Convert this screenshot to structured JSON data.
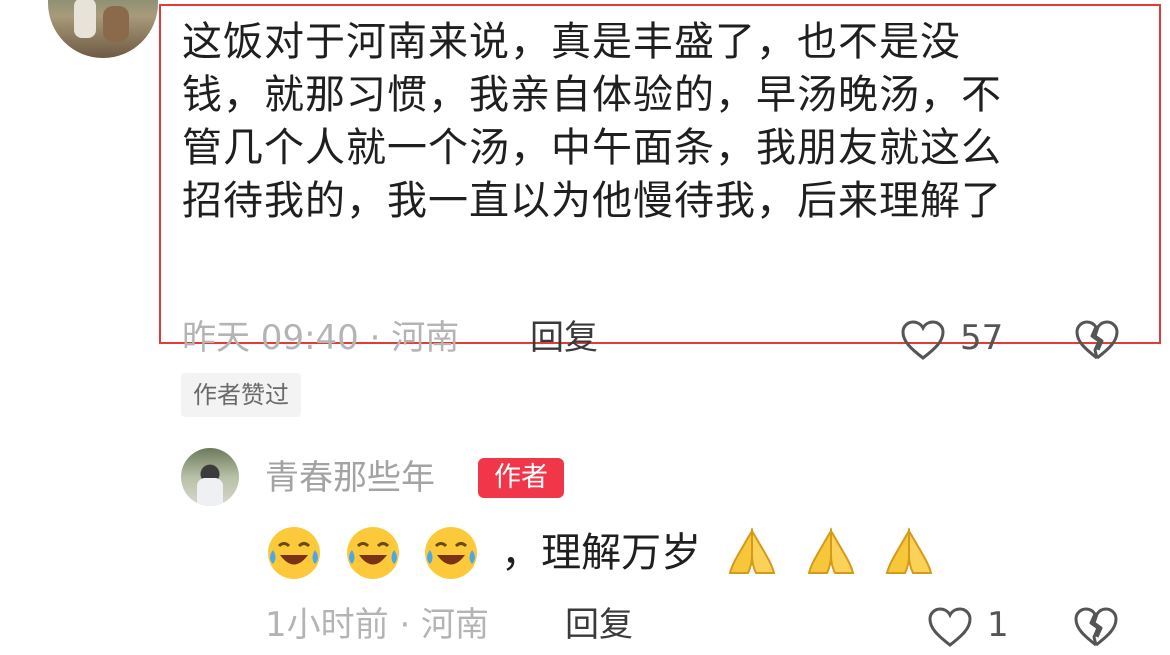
{
  "comment": {
    "lines": [
      "这饭对于河南来说，真是丰盛了，也不是没",
      "钱，就那习惯，我亲自体验的，早汤晚汤，不",
      "管几个人就一个汤，中午面条，我朋友就这么",
      "招待我的，我一直以为他慢待我，后来理解了"
    ],
    "time_location": "昨天 09:40 · 河南",
    "reply_label": "回复",
    "like_count": "57",
    "author_liked_badge": "作者赞过"
  },
  "reply": {
    "username": "青春那些年",
    "author_badge": "作者",
    "text": "，理解万岁",
    "emojis": [
      "laughing-tears-icon",
      "laughing-tears-icon",
      "laughing-tears-icon",
      "praying-hands-icon",
      "praying-hands-icon",
      "praying-hands-icon"
    ],
    "time_location": "1小时前 · 河南",
    "reply_label": "回复",
    "like_count": "1"
  },
  "colors": {
    "highlight_border": "#e23b3b",
    "author_badge_bg": "#f2364a",
    "muted_text": "#b4b4b4"
  }
}
